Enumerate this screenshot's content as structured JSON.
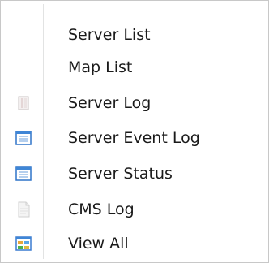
{
  "menu": {
    "items": [
      {
        "label": "Server List",
        "icon": "none",
        "enabled": true
      },
      {
        "label": "Map List",
        "icon": "none",
        "enabled": true
      },
      {
        "label": "Server Log",
        "icon": "disabled-document-icon",
        "enabled": true
      },
      {
        "label": "Server Event Log",
        "icon": "list-document-icon",
        "enabled": true
      },
      {
        "label": "Server Status",
        "icon": "list-document-icon",
        "enabled": true
      },
      {
        "label": "CMS Log",
        "icon": "disabled-page-icon",
        "enabled": true
      },
      {
        "label": "View All",
        "icon": "grid-view-icon",
        "enabled": true
      }
    ]
  }
}
